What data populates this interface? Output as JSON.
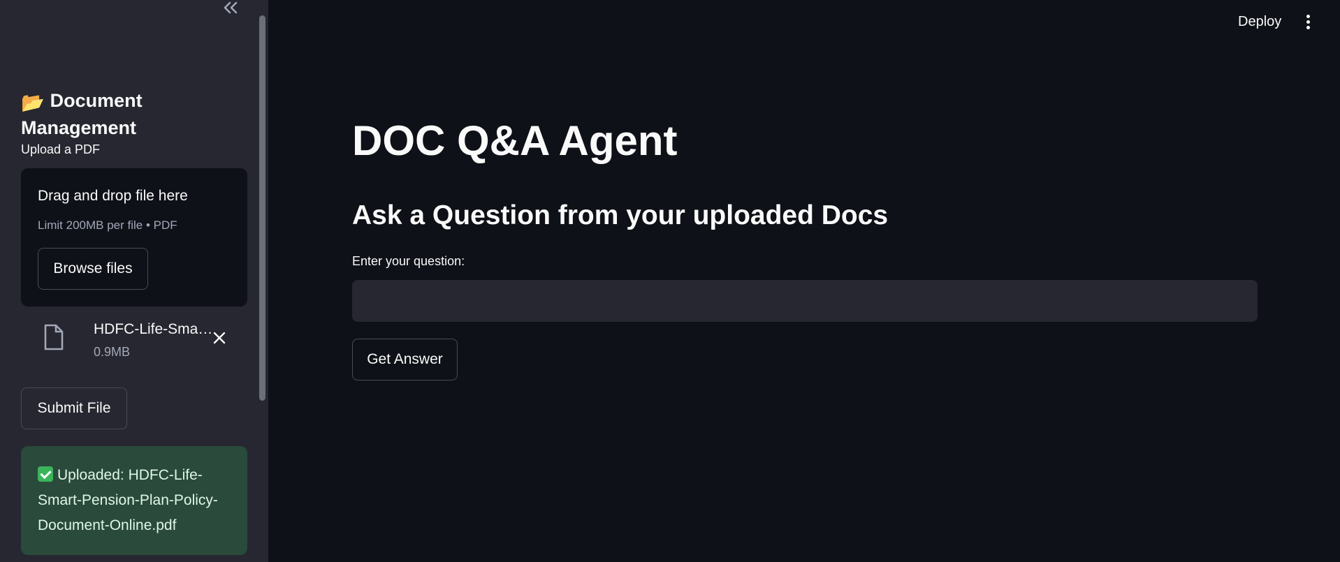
{
  "sidebar": {
    "title_emoji": "📂",
    "title": "Document Management",
    "upload_label": "Upload a PDF",
    "dropzone": {
      "title": "Drag and drop file here",
      "limit": "Limit 200MB per file • PDF",
      "browse_label": "Browse files"
    },
    "uploaded_file": {
      "name": "HDFC-Life-Smart-Pension-Plan-Policy-Document-Online.pdf",
      "size": "0.9MB"
    },
    "submit_label": "Submit File",
    "success_message": "Uploaded: HDFC-Life-Smart-Pension-Plan-Policy-Document-Online.pdf"
  },
  "header": {
    "deploy_label": "Deploy"
  },
  "main": {
    "title": "DOC Q&A Agent",
    "subtitle": "Ask a Question from your uploaded Docs",
    "question_label": "Enter your question:",
    "question_value": "",
    "answer_button": "Get Answer"
  },
  "colors": {
    "background": "#0e1117",
    "sidebar": "#262730",
    "success_bg": "#2a4a3b",
    "text": "#fafafa"
  }
}
